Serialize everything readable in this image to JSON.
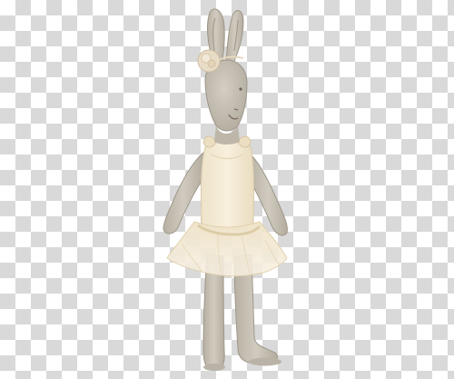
{
  "image": {
    "subject": "plush-bunny-ballerina",
    "background": "transparency-checkerboard",
    "colors": {
      "linen": "#c8c2b6",
      "linen_shadow": "#a9a296",
      "tutu": "#f3ead6",
      "tutu_shadow": "#e6d8b9",
      "flower": "#e9dcc7",
      "checker_light": "#ffffff",
      "checker_dark": "#d9d9d9"
    }
  }
}
